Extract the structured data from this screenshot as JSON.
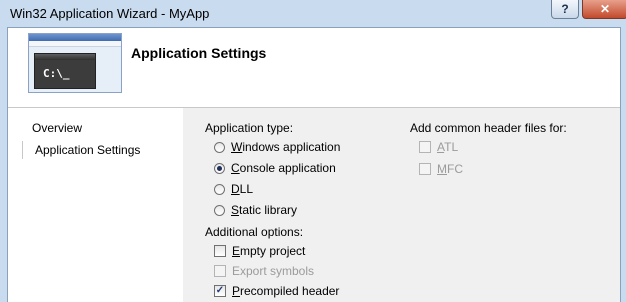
{
  "window": {
    "title": "Win32 Application Wizard - MyApp",
    "help_label": "?",
    "close_label": "✕"
  },
  "header": {
    "title": "Application Settings",
    "thumbnail_prompt": "C:\\_"
  },
  "sidebar": {
    "items": [
      {
        "label": "Overview"
      },
      {
        "label": "Application Settings"
      }
    ]
  },
  "settings": {
    "application_type": {
      "label": "Application type:",
      "options": [
        {
          "accel": "W",
          "rest": "indows application"
        },
        {
          "accel": "C",
          "rest": "onsole application"
        },
        {
          "accel": "D",
          "rest": "LL"
        },
        {
          "accel": "S",
          "rest": "tatic library"
        }
      ],
      "selected": "Console application"
    },
    "additional_options": {
      "label": "Additional options:",
      "empty_project": {
        "accel": "E",
        "rest": "mpty project",
        "checked": false,
        "enabled": true
      },
      "export_symbols": {
        "label": "Export symbols",
        "checked": false,
        "enabled": false
      },
      "precompiled_header": {
        "accel": "P",
        "rest": "recompiled header",
        "checked": true,
        "enabled": true,
        "mark": "✓"
      }
    },
    "common_headers": {
      "label": "Add common header files for:",
      "atl": {
        "accel": "A",
        "rest": "TL",
        "checked": false,
        "enabled": false
      },
      "mfc": {
        "accel": "M",
        "rest": "FC",
        "checked": false,
        "enabled": false
      }
    }
  }
}
